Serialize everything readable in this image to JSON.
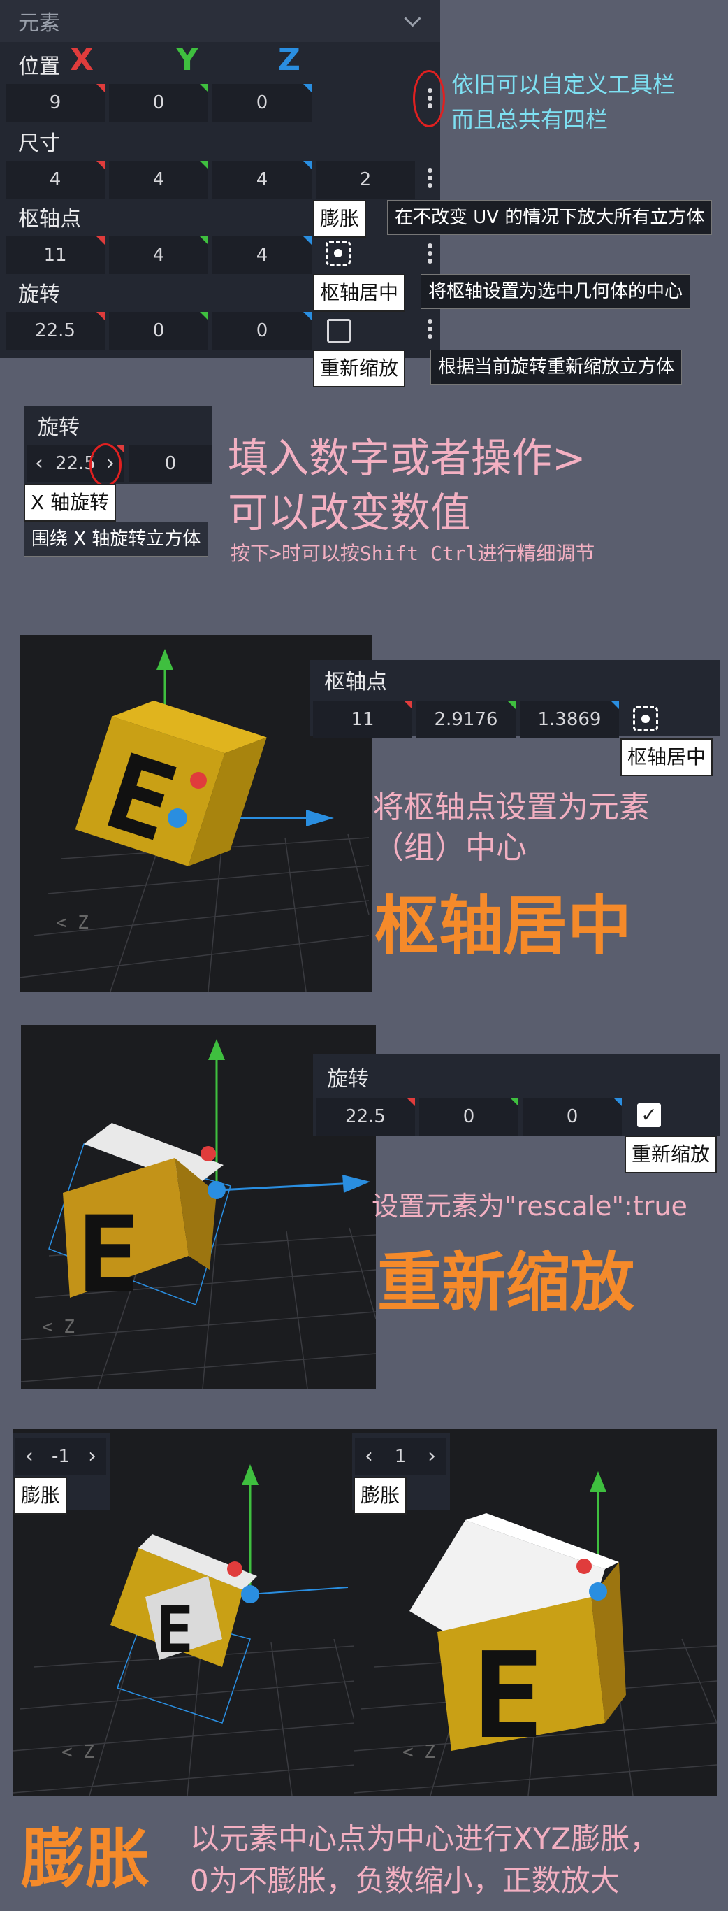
{
  "panel1": {
    "title": "元素",
    "position": {
      "label": "位置",
      "x_axis": "X",
      "y_axis": "Y",
      "z_axis": "Z",
      "values": [
        "9",
        "0",
        "0"
      ]
    },
    "size": {
      "label": "尺寸",
      "values": [
        "4",
        "4",
        "4",
        "2"
      ]
    },
    "pivot": {
      "label": "枢轴点",
      "values": [
        "11",
        "4",
        "4"
      ]
    },
    "rotation": {
      "label": "旋转",
      "values": [
        "22.5",
        "0",
        "0"
      ]
    },
    "tooltips": {
      "inflate_label": "膨胀",
      "inflate_desc": "在不改变 UV 的情况下放大所有立方体",
      "center_label": "枢轴居中",
      "center_desc": "将枢轴设置为选中几何体的中心",
      "rescale_label": "重新缩放",
      "rescale_desc": "根据当前旋转重新缩放立方体"
    },
    "annotation": [
      "依旧可以自定义工具栏",
      "而且总共有四栏"
    ]
  },
  "panel2": {
    "title": "旋转",
    "value": "22.5",
    "value2": "0",
    "tooltip_title": "X 轴旋转",
    "tooltip_desc": "围绕 X 轴旋转立方体",
    "annotation_big": [
      "填入数字或者操作>",
      "可以改变数值"
    ],
    "annotation_small": "按下>时可以按Shift Ctrl进行精细调节"
  },
  "panel3": {
    "title": "枢轴点",
    "values": [
      "11",
      "2.9176",
      "1.3869"
    ],
    "button_tooltip": "枢轴居中",
    "desc": [
      "将枢轴点设置为元素",
      "（组）中心"
    ],
    "big_title": "枢轴居中"
  },
  "panel4": {
    "title": "旋转",
    "values": [
      "22.5",
      "0",
      "0"
    ],
    "checkbox_tooltip": "重新缩放",
    "desc": "设置元素为\"rescale\":true",
    "big_title": "重新缩放"
  },
  "panel5": {
    "left": {
      "value": "-1",
      "label": "膨胀"
    },
    "right": {
      "value": "1",
      "label": "膨胀"
    },
    "big_title": "膨胀",
    "desc": [
      "以元素中心点为中心进行XYZ膨胀，",
      "0为不膨胀，负数缩小，正数放大"
    ]
  },
  "colors": {
    "accent_orange": "#f58a2a",
    "cyan": "#7ee0f2",
    "pink": "#f3b0c2",
    "x_red": "#e03c3c",
    "y_green": "#3fbf3f",
    "z_blue": "#2a8ee0"
  }
}
